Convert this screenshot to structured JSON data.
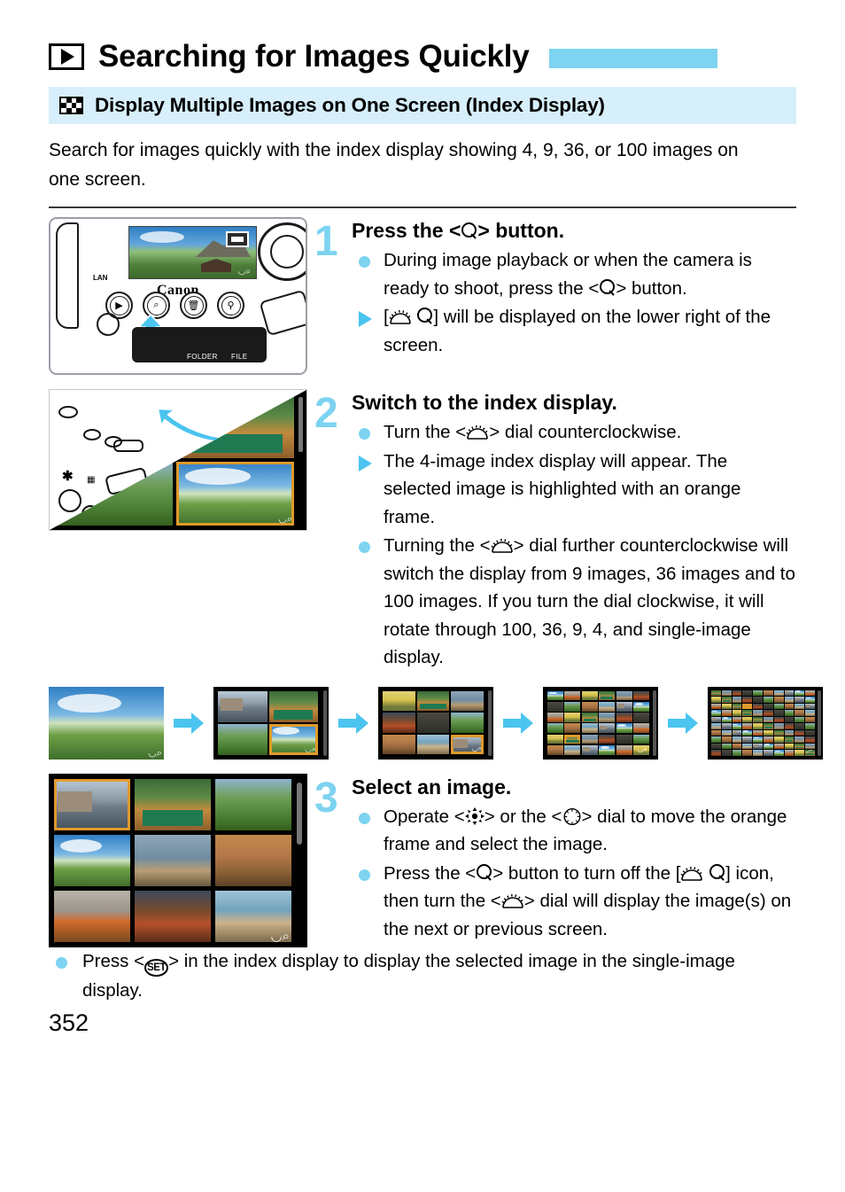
{
  "page": {
    "number": "352",
    "title": "Searching for Images Quickly",
    "title_icon": "playback-icon",
    "section_heading": "Display Multiple Images on One Screen (Index Display)",
    "section_icon": "index-grid-icon",
    "intro": "Search for images quickly with the index display showing 4, 9, 36, or 100 images on one screen.",
    "accent_color": "#7DD3F0",
    "band_color": "#D6EFFA",
    "arrow_color": "#4BC4F0",
    "selection_frame_color": "#E09A2B"
  },
  "steps": [
    {
      "number": "1",
      "title_pre": "Press the <",
      "title_icon": "magnify-icon",
      "title_post": "> button.",
      "title_plain": "Press the <Q> button.",
      "bullets": [
        {
          "marker": "dot",
          "parts": [
            "During image playback or when the camera is ready to shoot, press the <",
            "magnify-icon",
            "> button."
          ],
          "plain": "During image playback or when the camera is ready to shoot, press the <Q> button."
        },
        {
          "marker": "triangle",
          "parts": [
            "[",
            "main-dial-icon",
            "magnify-icon",
            "] will be displayed on the lower right of the screen."
          ],
          "plain": "[dial Q] will be displayed on the lower right of the screen."
        }
      ],
      "figure": {
        "name": "camera-back-illustration",
        "brand": "Canon",
        "lcd_labels": [
          "FOLDER",
          "FILE"
        ],
        "lan_label": "LAN"
      }
    },
    {
      "number": "2",
      "title_plain": "Switch to the index display.",
      "bullets": [
        {
          "marker": "dot",
          "plain": "Turn the <dial> dial counterclockwise.",
          "pre": "Turn the <",
          "icon": "main-dial-icon",
          "post": "> dial counterclockwise."
        },
        {
          "marker": "triangle",
          "plain": "The 4-image index display will appear. The selected image is highlighted with an orange frame.",
          "pre": "The 4-image index display will appear. The selected image is highlighted with an orange frame.",
          "icon": "",
          "post": ""
        },
        {
          "marker": "dot",
          "plain": "Turning the <dial> dial further counterclockwise will switch the display from 9 images, 36 images and to 100 images. If you turn the dial clockwise, it will rotate through 100, 36, 9, 4, and single-image display.",
          "pre": "Turning the <",
          "icon": "main-dial-icon",
          "post": "> dial further counterclockwise will switch the display from 9 images, 36 images and to 100 images. If you turn the dial clockwise, it will rotate through 100, 36, 9, 4, and single-image display."
        }
      ],
      "figure": {
        "name": "dial-and-4-image-index-illustration"
      }
    },
    {
      "number": "3",
      "title_plain": "Select an image.",
      "bullets": [
        {
          "marker": "dot",
          "plain": "Operate <multi-controller> or the <quick-control-dial> dial to move the orange frame and select the image."
        },
        {
          "marker": "dot",
          "plain": "Press the <Q> button to turn off the [dial Q] icon, then turn the <dial> dial will display the image(s) on the next or previous screen."
        }
      ],
      "figure": {
        "name": "nine-image-index-illustration"
      }
    }
  ],
  "progression": {
    "name": "index-display-progression",
    "screens": [
      {
        "label": "1 image",
        "count": 1,
        "cols": 1,
        "rows": 1
      },
      {
        "label": "4 images",
        "count": 4,
        "cols": 2,
        "rows": 2
      },
      {
        "label": "9 images",
        "count": 9,
        "cols": 3,
        "rows": 3
      },
      {
        "label": "36 images",
        "count": 36,
        "cols": 6,
        "rows": 6
      },
      {
        "label": "100 images",
        "count": 100,
        "cols": 10,
        "rows": 10
      }
    ],
    "arrow_count": 4
  },
  "footer": {
    "bullet_plain": "Press <SET> in the index display to display the selected image in the single-image display.",
    "bullet_pre": "Press <",
    "bullet_icon": "set-button-icon",
    "bullet_post": "> in the index display to display the selected image in the single-image display."
  }
}
